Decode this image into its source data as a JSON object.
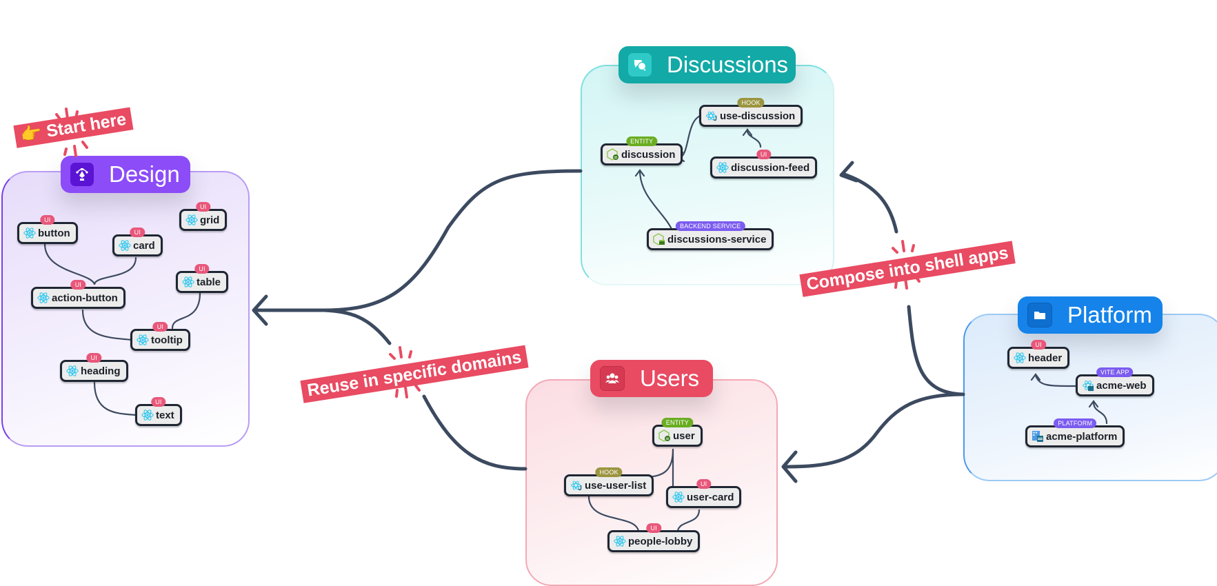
{
  "groups": {
    "design": {
      "title": "Design",
      "icon": "pen-tool-icon",
      "color": "#8c4cf8",
      "icon_bg": "#5b14d4"
    },
    "discussions": {
      "title": "Discussions",
      "icon": "chat-bubbles-icon",
      "color": "#12a9a6",
      "icon_bg": "#26c6c4"
    },
    "users": {
      "title": "Users",
      "icon": "people-icon",
      "color": "#e84b62",
      "icon_bg": "#d63a52"
    },
    "platform": {
      "title": "Platform",
      "icon": "folder-icon",
      "color": "#1583ea",
      "icon_bg": "#0e6fd0"
    }
  },
  "badge_colors": {
    "UI": "#e8577a",
    "HOOK": "#9b9540",
    "ENTITY": "#6aad22",
    "BACKEND SERVICE": "#7b5cf0",
    "VITE APP": "#7b5cf0",
    "PLATFORM": "#7b5cf0"
  },
  "nodes": {
    "button": {
      "label": "button",
      "badge": "UI",
      "icon": "react-icon"
    },
    "card": {
      "label": "card",
      "badge": "UI",
      "icon": "react-icon"
    },
    "grid": {
      "label": "grid",
      "badge": "UI",
      "icon": "react-icon"
    },
    "table": {
      "label": "table",
      "badge": "UI",
      "icon": "react-icon"
    },
    "action_button": {
      "label": "action-button",
      "badge": "UI",
      "icon": "react-icon"
    },
    "tooltip": {
      "label": "tooltip",
      "badge": "UI",
      "icon": "react-icon"
    },
    "heading": {
      "label": "heading",
      "badge": "UI",
      "icon": "react-icon"
    },
    "text": {
      "label": "text",
      "badge": "UI",
      "icon": "react-icon"
    },
    "use_discussion": {
      "label": "use-discussion",
      "badge": "HOOK",
      "icon": "react-hook-icon"
    },
    "discussion": {
      "label": "discussion",
      "badge": "ENTITY",
      "icon": "node-entity-icon"
    },
    "discussion_feed": {
      "label": "discussion-feed",
      "badge": "UI",
      "icon": "react-icon"
    },
    "discussions_service": {
      "label": "discussions-service",
      "badge": "BACKEND SERVICE",
      "icon": "node-service-icon"
    },
    "user": {
      "label": "user",
      "badge": "ENTITY",
      "icon": "node-entity-icon"
    },
    "use_user_list": {
      "label": "use-user-list",
      "badge": "HOOK",
      "icon": "react-hook-icon"
    },
    "user_card": {
      "label": "user-card",
      "badge": "UI",
      "icon": "react-icon"
    },
    "people_lobby": {
      "label": "people-lobby",
      "badge": "UI",
      "icon": "react-icon"
    },
    "header": {
      "label": "header",
      "badge": "UI",
      "icon": "react-icon"
    },
    "acme_web": {
      "label": "acme-web",
      "badge": "VITE APP",
      "icon": "react-app-icon"
    },
    "acme_platform": {
      "label": "acme-platform",
      "badge": "PLATFORM",
      "icon": "platform-icon"
    }
  },
  "callouts": {
    "start": {
      "text": "Start here",
      "emoji": "👉"
    },
    "reuse": {
      "text": "Reuse in specific domains"
    },
    "compose": {
      "text": "Compose into shell apps"
    }
  },
  "edge_color": "#3c4a60"
}
